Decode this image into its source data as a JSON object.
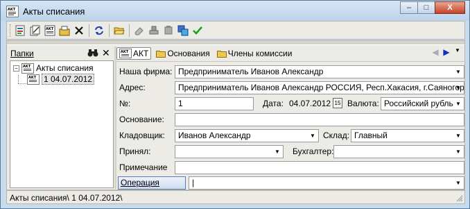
{
  "window": {
    "title": "Акты списания",
    "buttons": {
      "minimize": "–",
      "maximize": "□",
      "close": "X"
    }
  },
  "toolbar": {
    "icons": [
      "new-doc-icon",
      "copy-doc-icon",
      "akt-doc-icon",
      "edit-doc-icon",
      "delete-icon",
      "refresh-icon",
      "open-folder-icon",
      "eraser-icon",
      "seal-icon",
      "stamp-icon",
      "print-preview-icon",
      "check-icon"
    ]
  },
  "left_pane": {
    "title": "Папки",
    "tree": [
      {
        "label": "Акты списания",
        "expanded": true
      },
      {
        "label": "1 04.07.2012",
        "selected": true
      }
    ]
  },
  "tabs": [
    {
      "label": "АКТ",
      "active": true
    },
    {
      "label": "Основания",
      "active": false
    },
    {
      "label": "Члены комиссии",
      "active": false
    }
  ],
  "form": {
    "firm_label": "Наша фирма:",
    "firm_value": "Предприниматель Иванов Александр",
    "address_label": "Адрес:",
    "address_value": "Предприниматель Иванов Александр РОССИЯ, Респ.Хакасия, г.Саяногорск",
    "number_label": "№:",
    "number_value": "1",
    "date_label": "Дата:",
    "date_value": "04.07.2012",
    "calendar_label": "15",
    "currency_label": "Валюта:",
    "currency_value": "Российский рубль",
    "basis_label": "Основание:",
    "basis_value": "",
    "storekeeper_label": "Кладовщик:",
    "storekeeper_value": "Иванов Александр",
    "warehouse_label": "Склад:",
    "warehouse_value": "Главный",
    "accepted_label": "Принял:",
    "accepted_value": "",
    "accountant_label": "Бухгалтер:",
    "accountant_value": "",
    "note_label": "Примечание",
    "note_value": "",
    "operation_label": "Операция расход:",
    "operation_value": "|"
  },
  "status": {
    "text": "Акты списания\\ 1 04.07.2012\\"
  },
  "colors": {
    "window_bg": "#c7dbef",
    "panel_bg": "#ecebe6",
    "close_button": "#c5432a",
    "nav_arrow_active": "#1030c0"
  }
}
